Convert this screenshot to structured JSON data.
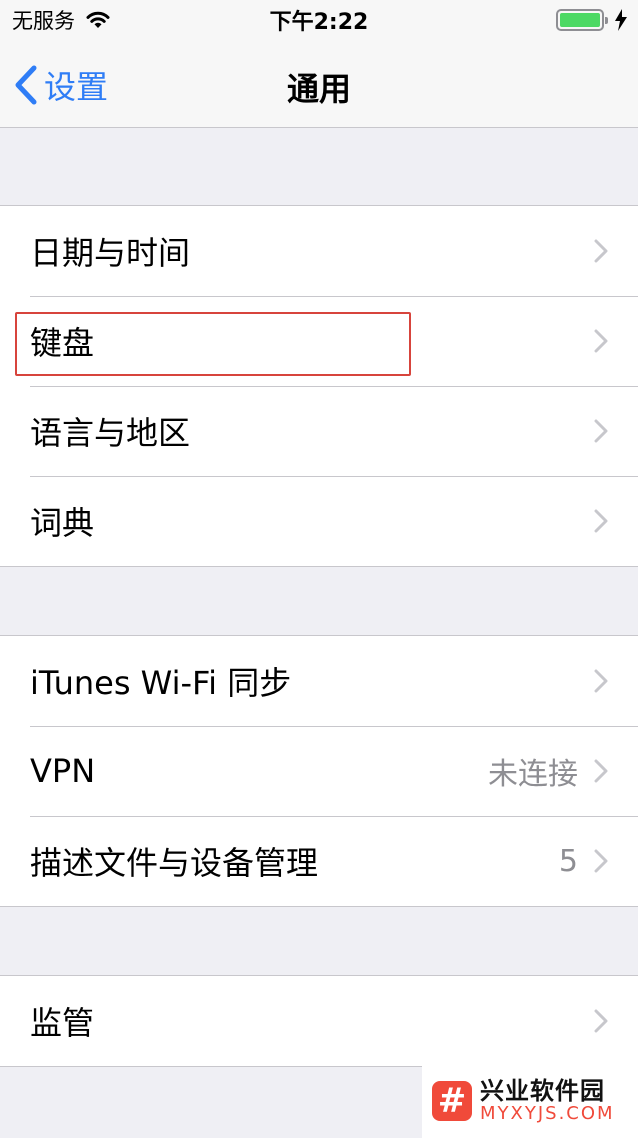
{
  "status_bar": {
    "carrier": "无服务",
    "time": "下午2:22",
    "battery_level": 1.0
  },
  "nav": {
    "back_label": "设置",
    "title": "通用"
  },
  "groups": [
    {
      "rows": [
        {
          "label": "日期与时间",
          "value": ""
        },
        {
          "label": "键盘",
          "value": ""
        },
        {
          "label": "语言与地区",
          "value": ""
        },
        {
          "label": "词典",
          "value": ""
        }
      ]
    },
    {
      "rows": [
        {
          "label": "iTunes Wi-Fi 同步",
          "value": ""
        },
        {
          "label": "VPN",
          "value": "未连接"
        },
        {
          "label": "描述文件与设备管理",
          "value": "5"
        }
      ]
    },
    {
      "rows": [
        {
          "label": "监管",
          "value": ""
        }
      ]
    }
  ],
  "watermark": {
    "logo_glyph": "#",
    "title": "兴业软件园",
    "subtitle": "MYXYJS.COM"
  },
  "colors": {
    "accent": "#2f7df6",
    "highlight": "#d7443c",
    "battery": "#4cd964",
    "watermark": "#f04a3a"
  }
}
